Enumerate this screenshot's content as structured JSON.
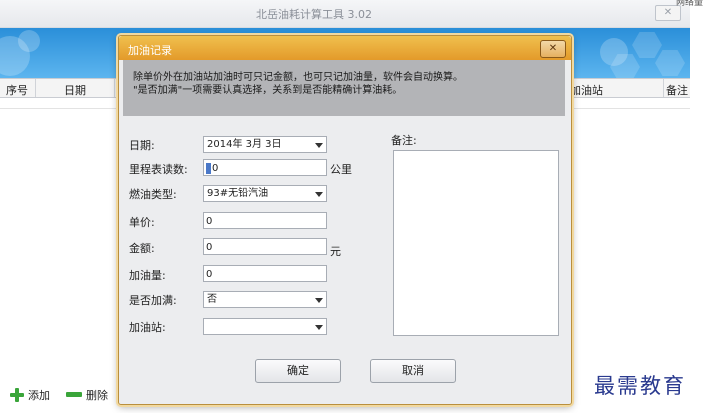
{
  "app": {
    "title": "北岳油耗计算工具 3.02",
    "close_symbol": "✕",
    "corner_text": "网络量"
  },
  "grid": {
    "columns": [
      "序号",
      "日期",
      "加油站",
      "备注"
    ]
  },
  "toolbar": {
    "add_label": "添加",
    "delete_label": "删除"
  },
  "watermark": "最需教育",
  "dialog": {
    "title": "加油记录",
    "close_symbol": "✕",
    "notice_line1": "除单价外在加油站加油时可只记金额，也可只记加油量，软件会自动换算。",
    "notice_line2": "\"是否加满\"一项需要认真选择，关系到是否能精确计算油耗。",
    "fields": {
      "date_label": "日期:",
      "date_value": "2014年  3月  3日",
      "odometer_label": "里程表读数:",
      "odometer_value": "0",
      "odometer_unit": "公里",
      "fuel_type_label": "燃油类型:",
      "fuel_type_value": "93#无铅汽油",
      "price_label": "单价:",
      "price_value": "0",
      "amount_label": "金额:",
      "amount_value": "0",
      "amount_unit": "元",
      "volume_label": "加油量:",
      "volume_value": "0",
      "full_label": "是否加满:",
      "full_value": "否",
      "station_label": "加油站:",
      "station_value": ""
    },
    "notes_label": "备注:",
    "ok_label": "确定",
    "cancel_label": "取消"
  },
  "colors": {
    "banner": "#3a9de3",
    "dialog_title": "#e8a83a",
    "notice_bg": "#b3b4b7",
    "watermark": "#2a3a8f",
    "add_icon": "#3aa53a",
    "delete_icon": "#3aa53a"
  },
  "icons": {
    "add": "plus-icon",
    "delete": "minus-icon",
    "dropdown": "chevron-down-icon"
  }
}
